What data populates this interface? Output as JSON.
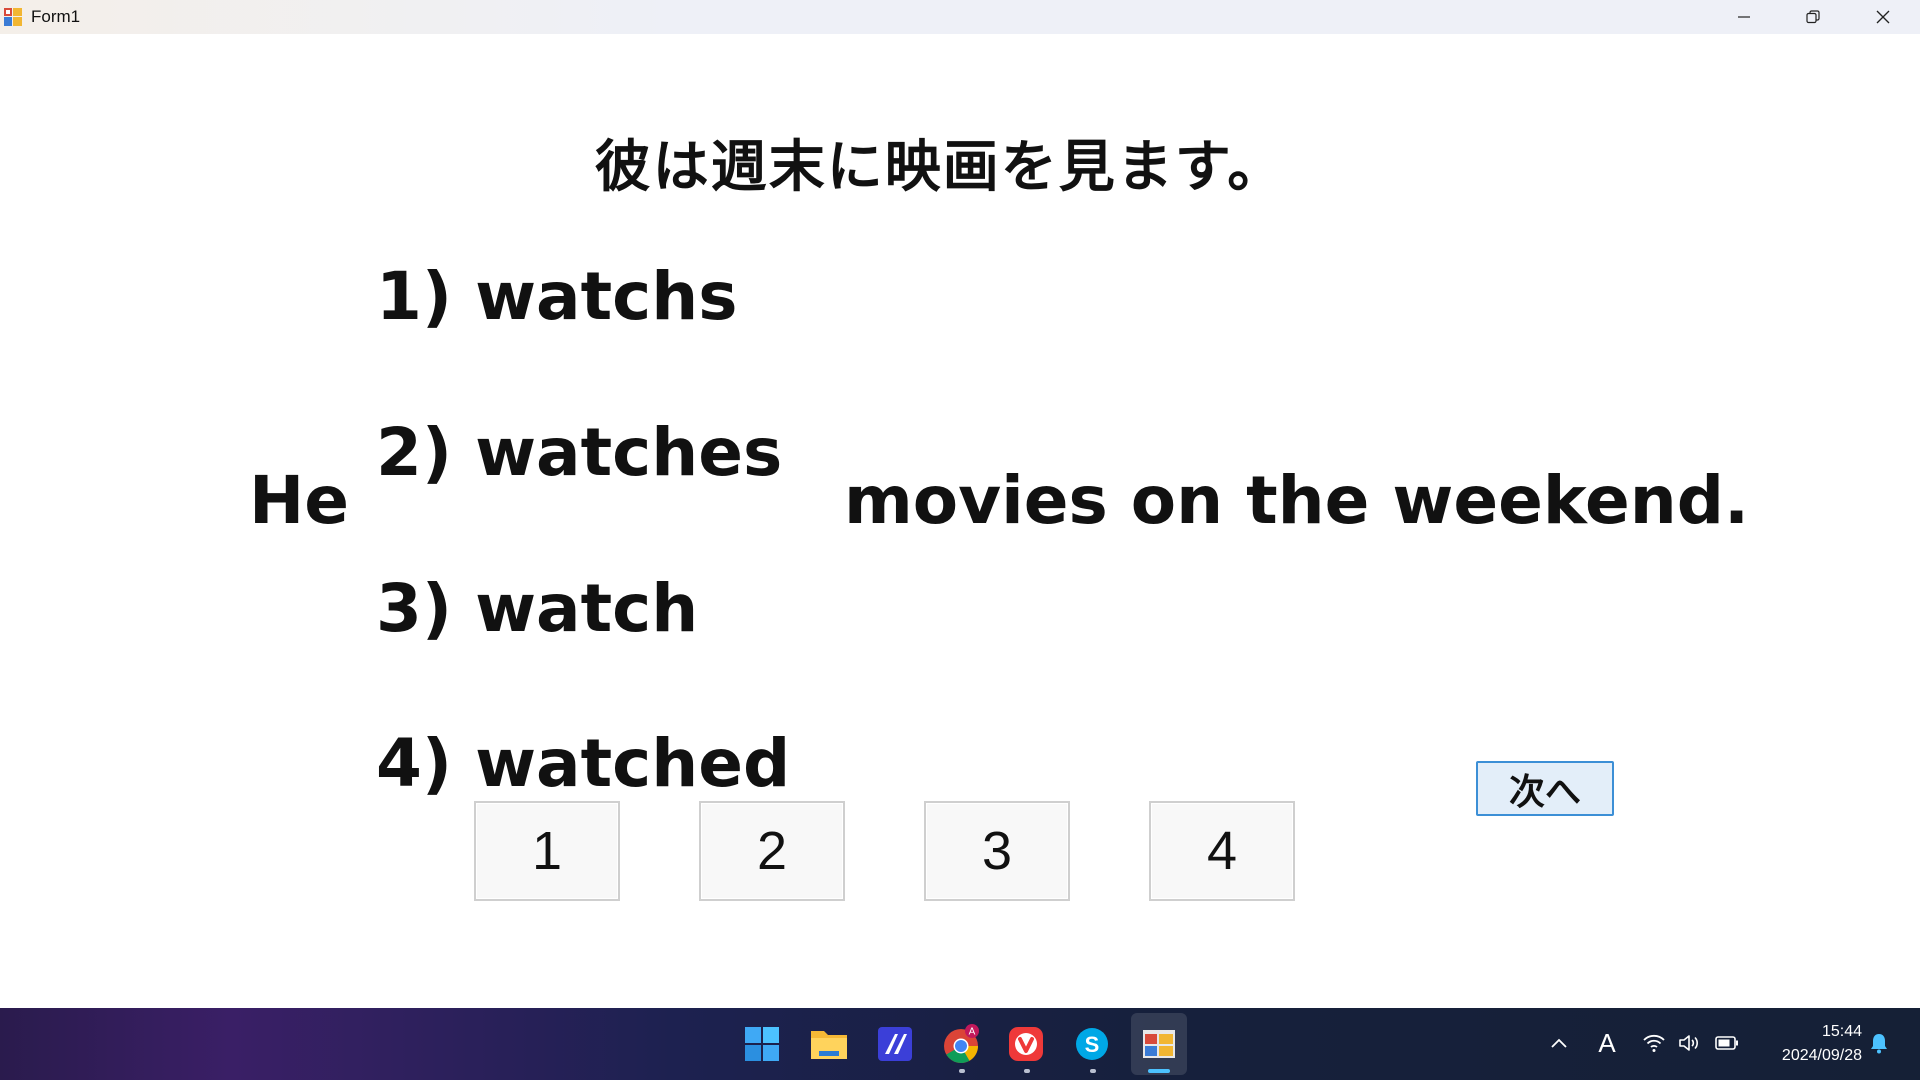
{
  "window": {
    "title": "Form1",
    "controls": {
      "minimize": "minimize",
      "maximize": "restore",
      "close": "close"
    }
  },
  "quiz": {
    "question_ja": "彼は週末に映画を見ます。",
    "sentence_start": "He",
    "sentence_end": "movies on the weekend.",
    "choices": [
      {
        "number": "1)",
        "text": "watchs"
      },
      {
        "number": "2)",
        "text": "watches"
      },
      {
        "number": "3)",
        "text": "watch"
      },
      {
        "number": "4)",
        "text": "watched"
      }
    ],
    "answer_buttons": [
      "1",
      "2",
      "3",
      "4"
    ],
    "next_label": "次へ"
  },
  "taskbar": {
    "apps": [
      "windows-start",
      "file-explorer",
      "editor-app",
      "chrome",
      "vivaldi",
      "skype",
      "form-app"
    ],
    "chrome_badge": "A",
    "ime_indicator": "A",
    "time": "15:44",
    "date": "2024/09/28"
  },
  "colors": {
    "accent": "#3c8fd6",
    "next_button_bg": "#e3eef9",
    "taskbar_active": "#4cc2ff"
  }
}
